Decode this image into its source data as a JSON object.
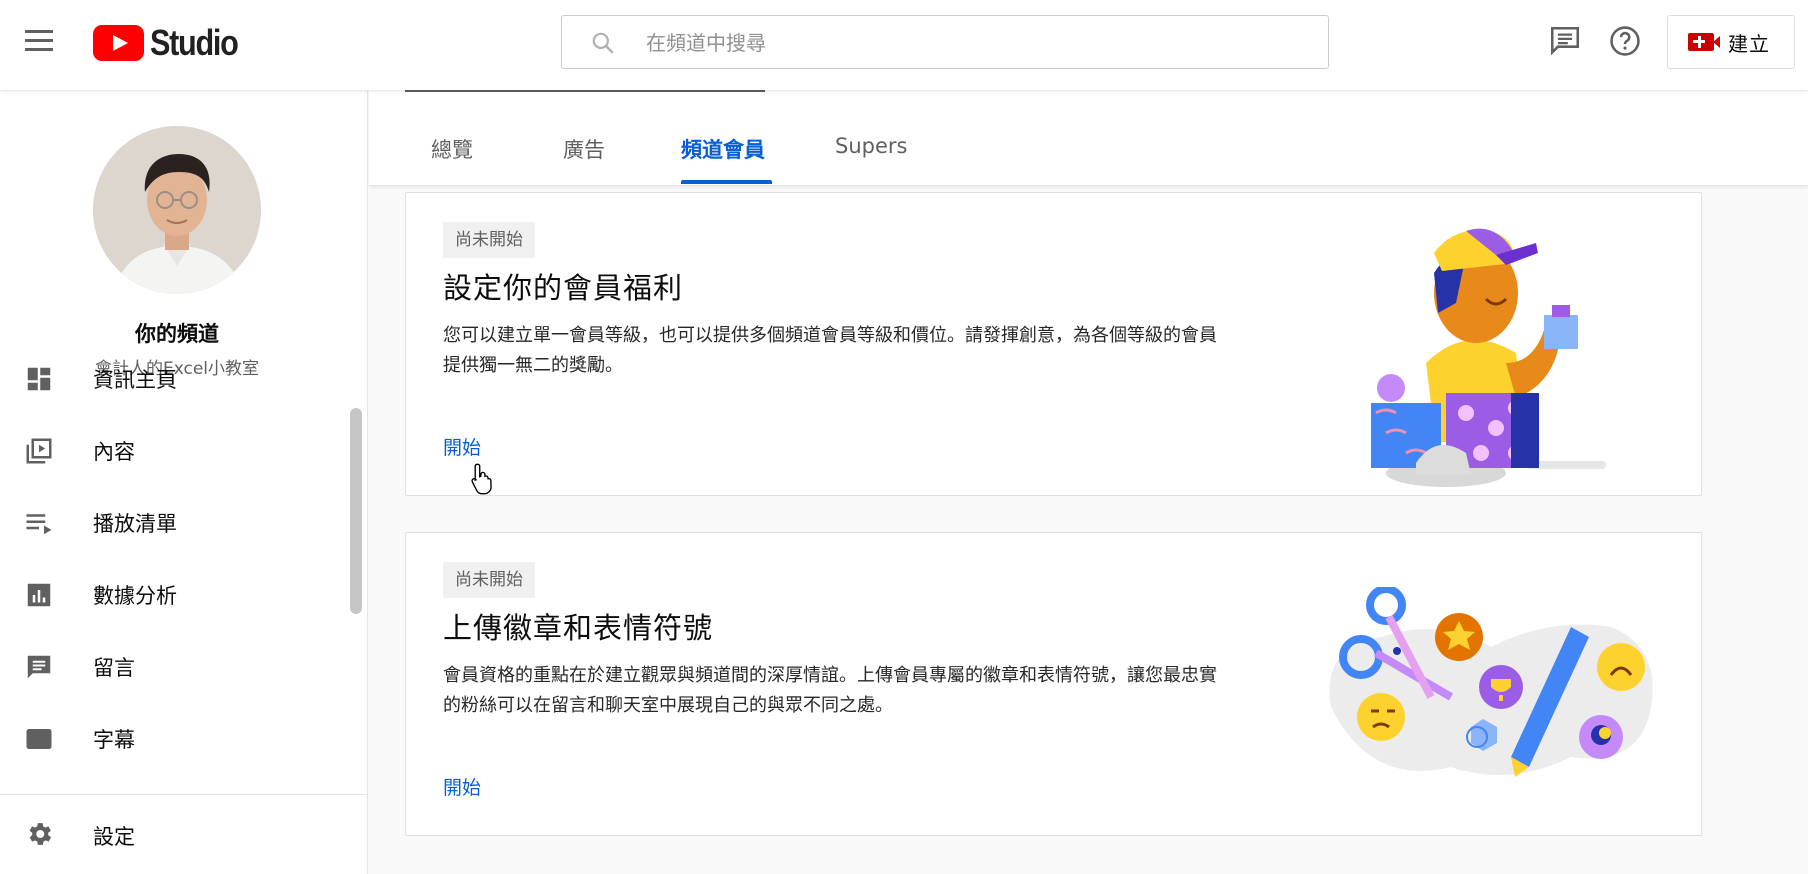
{
  "app": {
    "logo_text": "Studio"
  },
  "search": {
    "placeholder": "在頻道中搜尋"
  },
  "topbar": {
    "create_label": "建立"
  },
  "sidebar": {
    "channel_title": "你的頻道",
    "channel_subtitle": "會計人的Excel小教室",
    "items": [
      {
        "label": "資訊主頁",
        "icon": "dashboard-icon"
      },
      {
        "label": "內容",
        "icon": "content-icon"
      },
      {
        "label": "播放清單",
        "icon": "playlist-icon"
      },
      {
        "label": "數據分析",
        "icon": "analytics-icon"
      },
      {
        "label": "留言",
        "icon": "comments-icon"
      },
      {
        "label": "字幕",
        "icon": "subtitles-icon"
      }
    ],
    "settings_label": "設定"
  },
  "tabs": [
    {
      "label": "總覽",
      "active": false
    },
    {
      "label": "廣告",
      "active": false
    },
    {
      "label": "頻道會員",
      "active": true
    },
    {
      "label": "Supers",
      "active": false
    }
  ],
  "cards": [
    {
      "badge": "尚未開始",
      "title": "設定你的會員福利",
      "description": "您可以建立單一會員等級，也可以提供多個頻道會員等級和價位。請發揮創意，為各個等級的會員提供獨一無二的獎勵。",
      "link": "開始"
    },
    {
      "badge": "尚未開始",
      "title": "上傳徽章和表情符號",
      "description": "會員資格的重點在於建立觀眾與頻道間的深厚情誼。上傳會員專屬的徽章和表情符號，讓您最忠實的粉絲可以在留言和聊天室中展現自己的與眾不同之處。",
      "link": "開始"
    }
  ],
  "colors": {
    "accent": "#065fd4",
    "brand": "#ff0000"
  }
}
